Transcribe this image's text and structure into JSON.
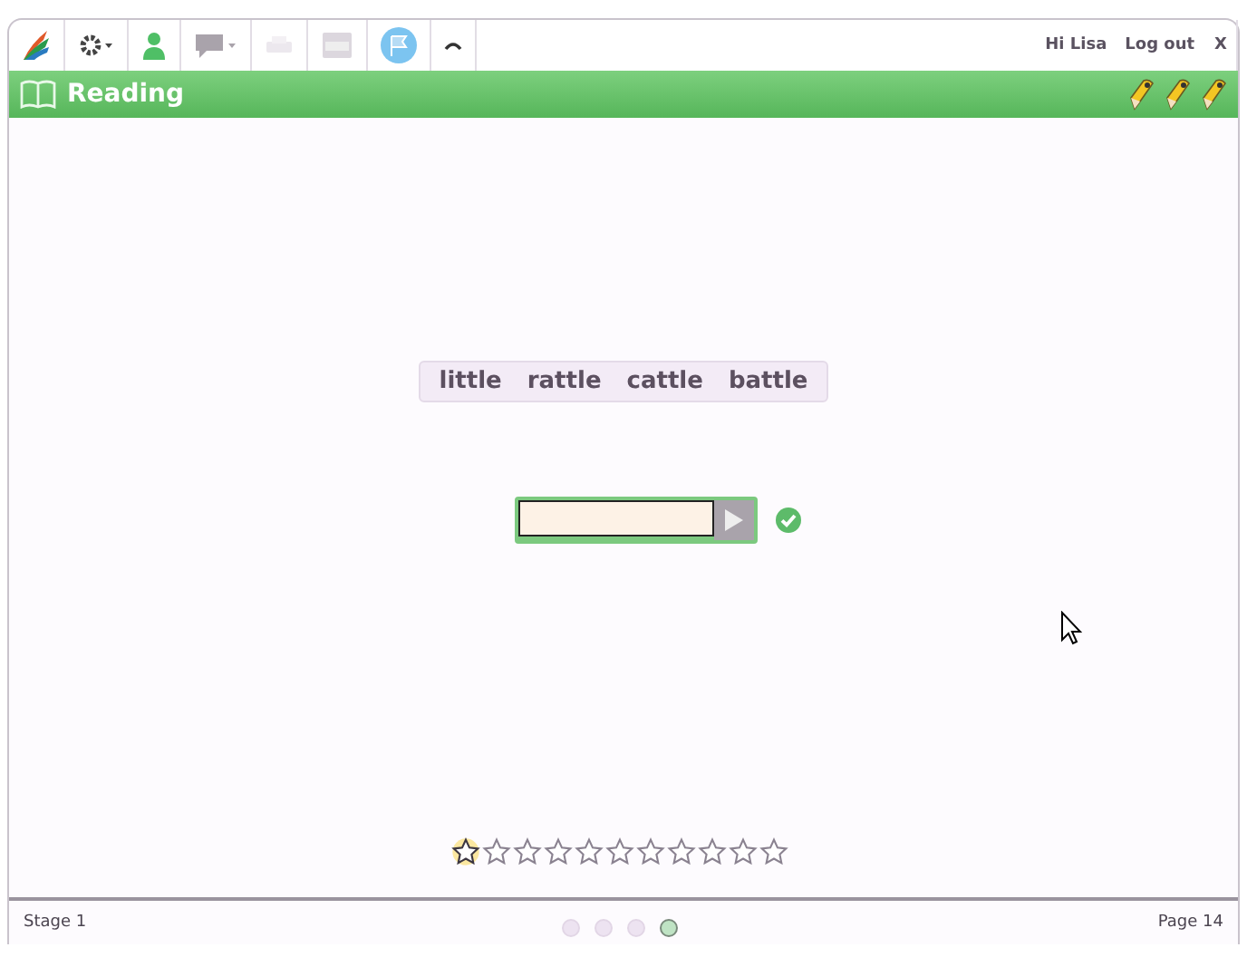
{
  "toolbar": {
    "greeting": "Hi Lisa",
    "logout": "Log out",
    "close": "X"
  },
  "header": {
    "title": "Reading"
  },
  "words": [
    "little",
    "rattle",
    "cattle",
    "battle"
  ],
  "answer": {
    "correct": true
  },
  "stars": [
    {
      "current": true
    },
    {
      "current": false
    },
    {
      "current": false
    },
    {
      "current": false
    },
    {
      "current": false
    },
    {
      "current": false
    },
    {
      "current": false
    },
    {
      "current": false
    },
    {
      "current": false
    },
    {
      "current": false
    },
    {
      "current": false
    }
  ],
  "footer": {
    "stage": "Stage 1",
    "page": "Page 14"
  },
  "pages": [
    {
      "selected": false
    },
    {
      "selected": false
    },
    {
      "selected": false
    },
    {
      "selected": true
    }
  ]
}
